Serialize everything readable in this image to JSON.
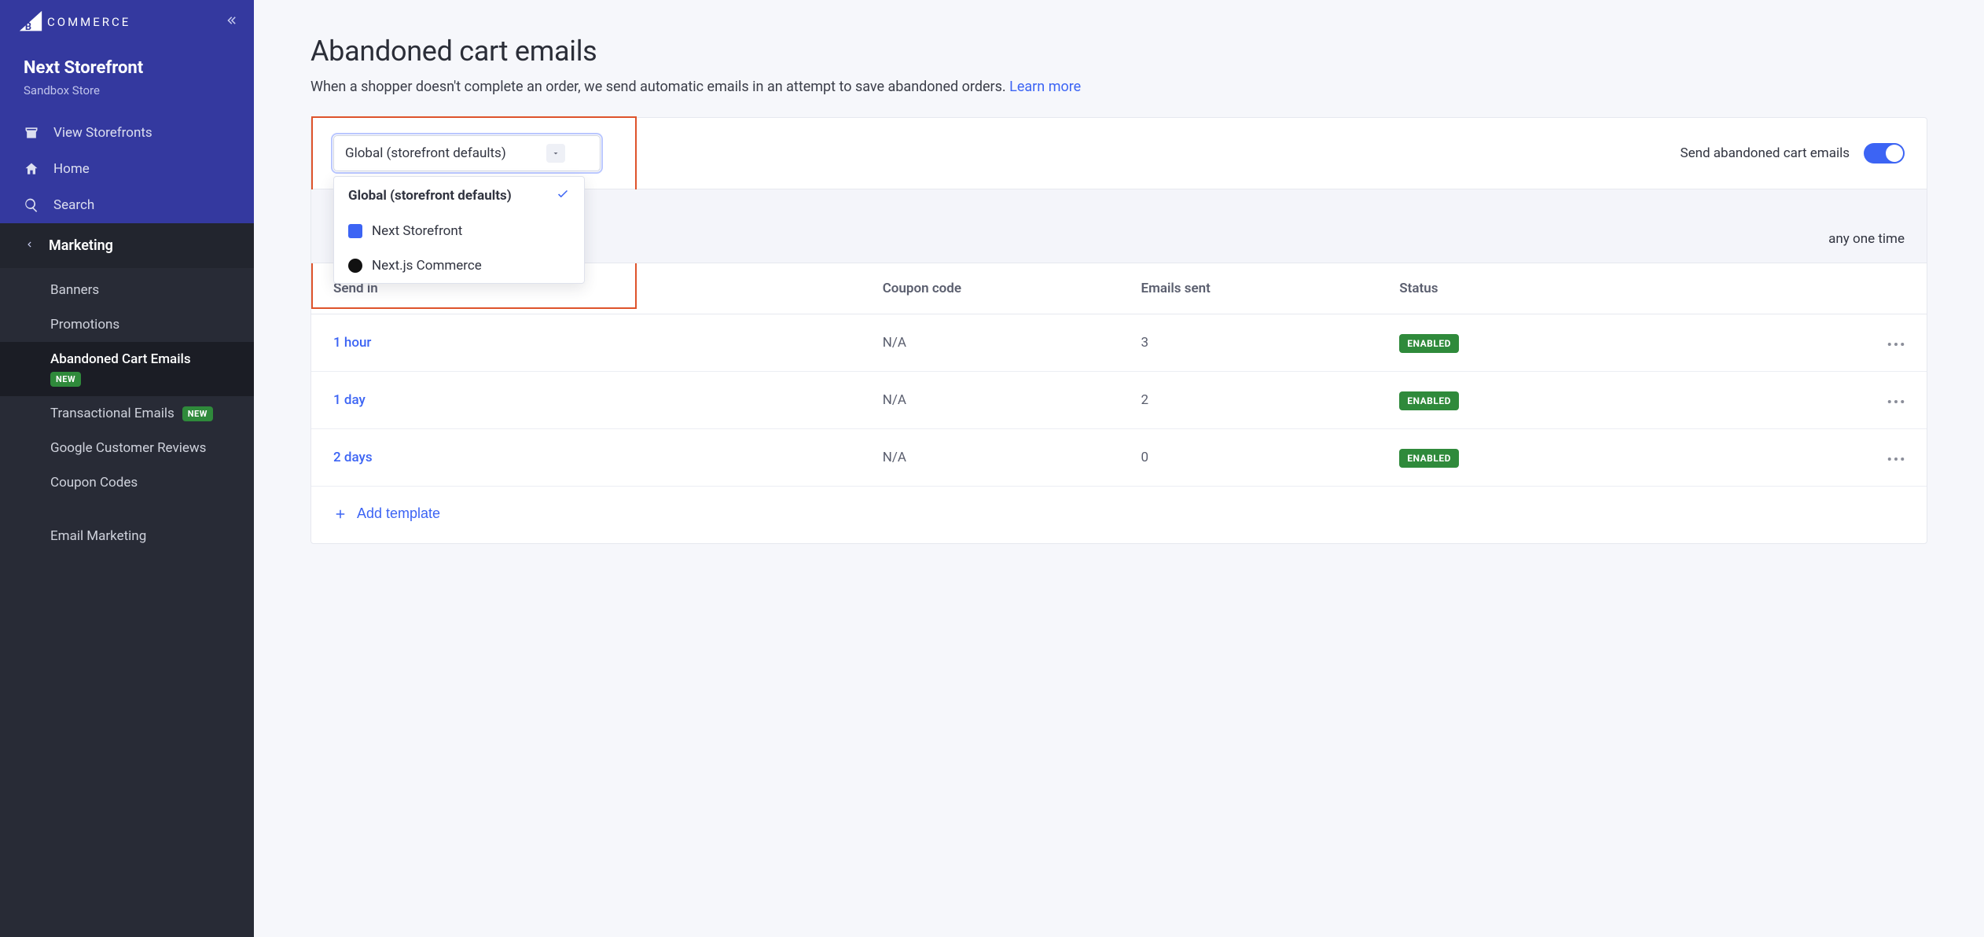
{
  "brand": {
    "name": "BIGCOMMERCE",
    "logo_text": "COMMERCE"
  },
  "store": {
    "name": "Next Storefront",
    "subtitle": "Sandbox Store"
  },
  "sidebar": {
    "items": [
      {
        "label": "View Storefronts"
      },
      {
        "label": "Home"
      },
      {
        "label": "Search"
      }
    ],
    "section": "Marketing",
    "submenu": [
      {
        "label": "Banners",
        "new": false,
        "active": false
      },
      {
        "label": "Promotions",
        "new": false,
        "active": false
      },
      {
        "label": "Abandoned Cart Emails",
        "new": true,
        "active": true
      },
      {
        "label": "Transactional Emails",
        "new": true,
        "active": false
      },
      {
        "label": "Google Customer Reviews",
        "new": false,
        "active": false
      },
      {
        "label": "Coupon Codes",
        "new": false,
        "active": false
      },
      {
        "label": "Email Marketing",
        "new": false,
        "active": false
      }
    ]
  },
  "page": {
    "title": "Abandoned cart emails",
    "description": "When a shopper doesn't complete an order, we send automatic emails in an attempt to save abandoned orders. ",
    "learn_more": "Learn more"
  },
  "selector": {
    "selected": "Global (storefront defaults)",
    "options": [
      {
        "label": "Global (storefront defaults)",
        "selected": true
      },
      {
        "label": "Next Storefront",
        "icon": "blue"
      },
      {
        "label": "Next.js Commerce",
        "icon": "black"
      }
    ]
  },
  "toggle": {
    "label": "Send abandoned cart emails",
    "on": true
  },
  "table": {
    "note_tail": "any one time",
    "headers": {
      "send_in": "Send in",
      "coupon": "Coupon code",
      "sent": "Emails sent",
      "status": "Status"
    },
    "rows": [
      {
        "send_in": "1 hour",
        "coupon": "N/A",
        "sent": "3",
        "status": "ENABLED"
      },
      {
        "send_in": "1 day",
        "coupon": "N/A",
        "sent": "2",
        "status": "ENABLED"
      },
      {
        "send_in": "2 days",
        "coupon": "N/A",
        "sent": "0",
        "status": "ENABLED"
      }
    ],
    "add_label": "Add template"
  },
  "colors": {
    "accent": "#3c64f4",
    "sidebar": "#34399f",
    "submenu": "#282b36",
    "highlight_box": "#de532b",
    "status_green": "#2f8a3b"
  }
}
